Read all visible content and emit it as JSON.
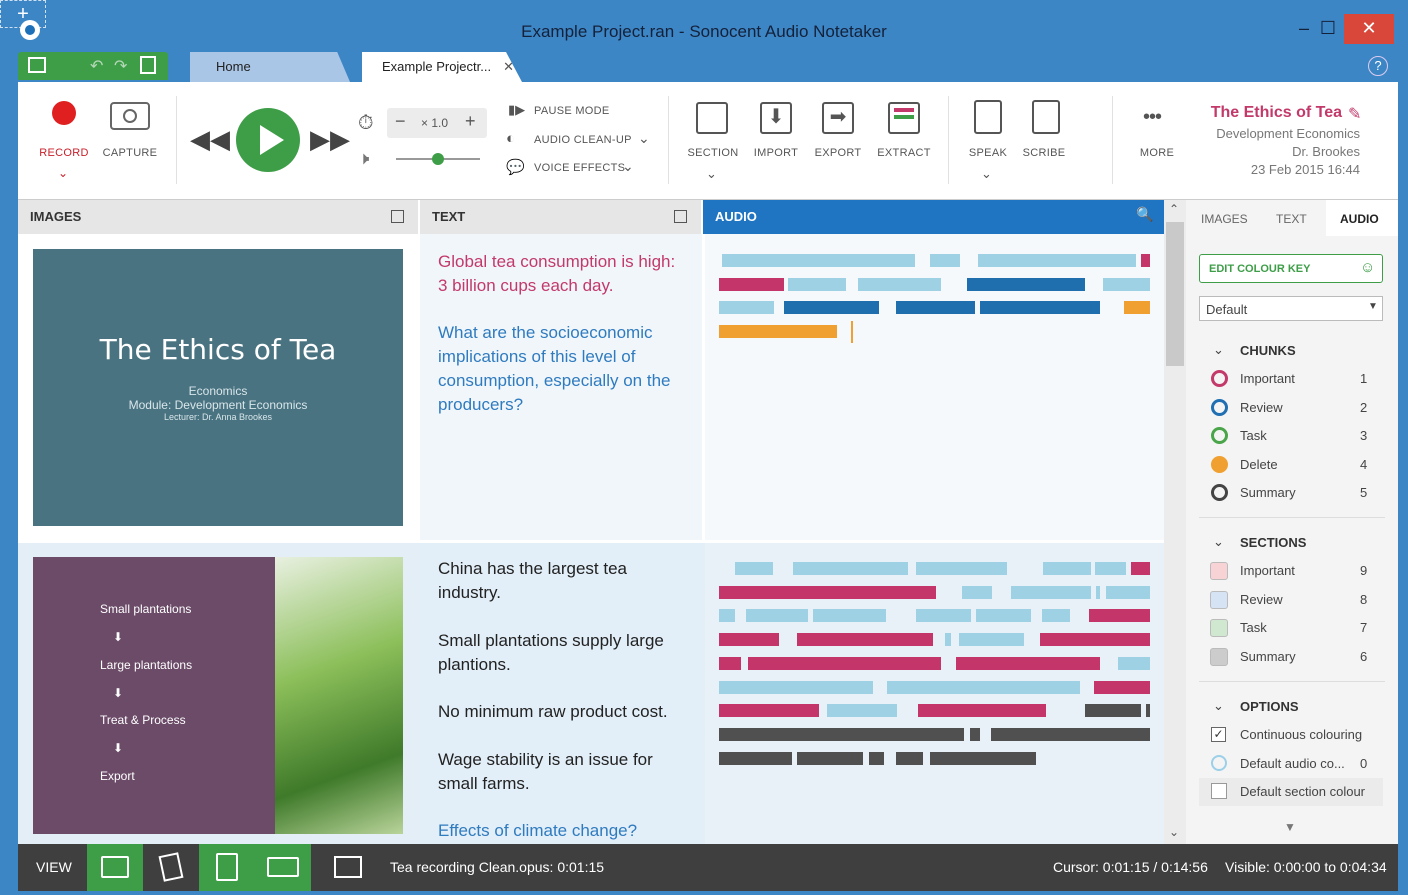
{
  "window": {
    "title": "Example Project.ran - Sonocent Audio Notetaker",
    "minimize": "–",
    "maximize": "☐",
    "close": "✕"
  },
  "tabs": {
    "home": "Home",
    "project": "Example Projectr...",
    "close": "✕",
    "new": "+",
    "help": "?"
  },
  "ribbon": {
    "record": "RECORD",
    "capture": "CAPTURE",
    "speed": "× 1.0",
    "minus": "−",
    "plus": "+",
    "pause_mode": "PAUSE MODE",
    "audio_cleanup": "AUDIO CLEAN-UP",
    "voice_effects": "VOICE EFFECTS",
    "section": "SECTION",
    "import": "IMPORT",
    "export": "EXPORT",
    "extract": "EXTRACT",
    "speak": "SPEAK",
    "scribe": "SCRIBE",
    "more": "MORE",
    "project_title": "The Ethics of Tea",
    "project_subject": "Development Economics",
    "project_author": "Dr. Brookes",
    "project_date": "23 Feb 2015 16:44"
  },
  "panels": {
    "images": "IMAGES",
    "text": "TEXT",
    "audio": "AUDIO"
  },
  "slide1": {
    "title": "The Ethics of Tea",
    "line1": "Economics",
    "line2": "Module: Development Economics",
    "line3": "Lecturer: Dr. Anna Brookes"
  },
  "slide2": {
    "items": [
      "Small plantations",
      "Large plantations",
      "Treat & Process",
      "Export"
    ],
    "arrow": "⬇"
  },
  "text_section1": {
    "p1": "Global tea consumption is high: 3 billion cups each day.",
    "p2": "What are the socioeconomic implications of this level of consumption, especially on the producers?"
  },
  "text_section2": {
    "p1": "China has the largest tea industry.",
    "p2": "Small plantations supply large plantions.",
    "p3": "No minimum raw product cost.",
    "p4": "Wage stability is an issue for small farms.",
    "p5": "Effects of climate change?"
  },
  "right_panel": {
    "tabs": [
      "IMAGES",
      "TEXT",
      "AUDIO"
    ],
    "edit_colour_key": "EDIT COLOUR KEY",
    "dropdown": "Default",
    "chunks_heading": "CHUNKS",
    "chunks": [
      {
        "label": "Important",
        "count": "1",
        "color": "#c2396a"
      },
      {
        "label": "Review",
        "count": "2",
        "color": "#1f6fb2"
      },
      {
        "label": "Task",
        "count": "3",
        "color": "#4aa54a"
      },
      {
        "label": "Delete",
        "count": "4",
        "color": "#f0a030"
      },
      {
        "label": "Summary",
        "count": "5",
        "color": "#444444"
      }
    ],
    "sections_heading": "SECTIONS",
    "sections": [
      {
        "label": "Important",
        "count": "9",
        "color": "#f7d3d6"
      },
      {
        "label": "Review",
        "count": "8",
        "color": "#d5e3f5"
      },
      {
        "label": "Task",
        "count": "7",
        "color": "#cfe8cf"
      },
      {
        "label": "Summary",
        "count": "6",
        "color": "#cccccc"
      }
    ],
    "options_heading": "OPTIONS",
    "options": [
      {
        "label": "Continuous colouring"
      },
      {
        "label": "Default audio co...",
        "count": "0"
      },
      {
        "label": "Default section colour"
      }
    ]
  },
  "statusbar": {
    "view": "VIEW",
    "file": "Tea recording Clean.opus: 0:01:15",
    "cursor": "Cursor:  0:01:15 / 0:14:56",
    "visible": "Visible:  0:00:00 to 0:04:34"
  }
}
